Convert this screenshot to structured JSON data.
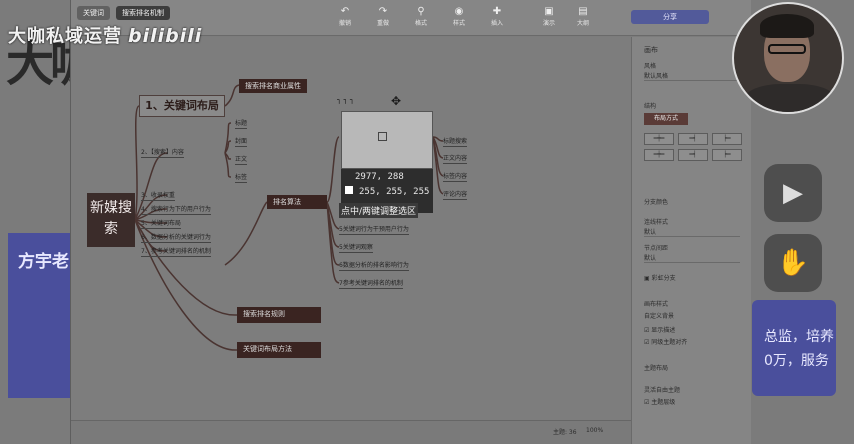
{
  "watermark": {
    "text": "大咖私域运营",
    "logo": "bilibili"
  },
  "background": {
    "left_title": "大咖",
    "left_box_text": "方宇老",
    "right_box_line1": "总监，培养",
    "right_box_line2": "0万，服务"
  },
  "app": {
    "tabs": [
      "关键词",
      "搜索排名机制"
    ],
    "toolbar": [
      {
        "icon": "undo-icon",
        "glyph": "↶",
        "label": "撤销"
      },
      {
        "icon": "redo-icon",
        "glyph": "↷",
        "label": "重做"
      },
      {
        "icon": "format-icon",
        "glyph": "⚲",
        "label": "格式"
      },
      {
        "icon": "style-icon",
        "glyph": "◉",
        "label": "样式"
      },
      {
        "icon": "insert-icon",
        "glyph": "✚",
        "label": "插入"
      }
    ],
    "right_tools": [
      {
        "icon": "present-icon",
        "glyph": "▣",
        "label": "演示"
      },
      {
        "icon": "layout-icon",
        "glyph": "▤",
        "label": "大纲"
      }
    ],
    "share_button": "分享"
  },
  "mindmap": {
    "root": "新媒搜索",
    "l1": "1、关键词布局",
    "top_dark": "搜索排名商业属性",
    "branch2": "2、【搜索】内容",
    "leaf_a": "标题",
    "leaf_b": "封面",
    "leaf_c": "正文",
    "leaf_d": "标签",
    "items": [
      "3、收录权重",
      "4、搜索行为下的用户行为",
      "5、关键词布局",
      "6、数据分析的关键词行为",
      "7、参考关键词排名的机制"
    ],
    "right_items": [
      "5关键词行为干预用户行为",
      "5关键词观察",
      "6数据分析的排名影响行为",
      "7参考关键词排名的机制"
    ],
    "far_right": [
      "标题搜索",
      "正文内容",
      "标签内容",
      "评论内容"
    ],
    "bottom_dark_1": "搜索排名规则",
    "bottom_dark_2": "关键词布局方法",
    "mid_dark": "排名算法"
  },
  "color_picker": {
    "coords": "2977, 288",
    "rgb": "255, 255, 255",
    "label": "点中/两键调整选区"
  },
  "panel": {
    "title": "画布",
    "theme_label": "风格",
    "theme_value": "默认风格",
    "structure_label": "结构",
    "layout_label": "布局方式",
    "branch_label": "分支颜色",
    "line_label": "连线样式",
    "line_value": "默认",
    "spacing_label": "节点间距",
    "spacing_value": "默认",
    "rainbow_label": "彩虹分支",
    "bg_label": "画布样式",
    "bg_value": "自定义背景",
    "check1": "显示描述",
    "check2": "同级主题对齐",
    "theme_section": "主题布局",
    "theme_item": "灵活自由主题",
    "check3": "主题层级"
  },
  "status": {
    "topics": "主题: 36",
    "zoom": "100%"
  }
}
